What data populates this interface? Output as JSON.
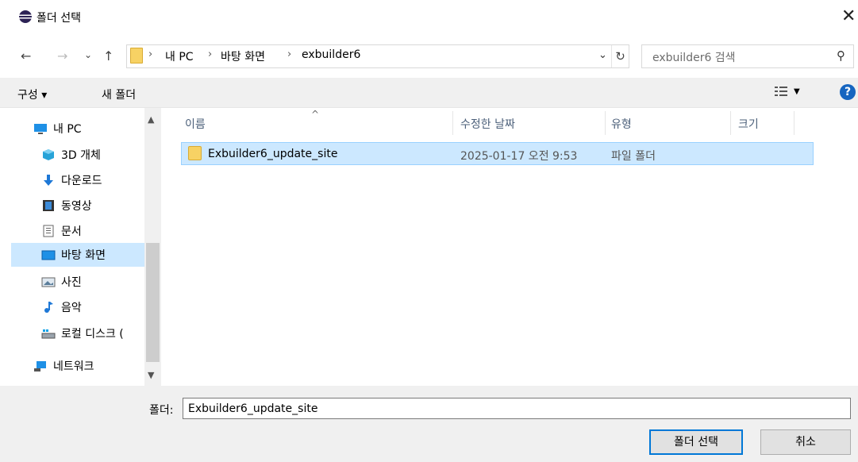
{
  "window": {
    "title": "폴더 선택",
    "close_glyph": "✕"
  },
  "nav_buttons": {
    "back": "←",
    "forward": "→",
    "recent": "⌄",
    "up": "↑"
  },
  "address": {
    "crumbs": [
      "내 PC",
      "바탕 화면",
      "exbuilder6"
    ],
    "separator": "›",
    "dropdown_glyph": "⌄",
    "refresh_glyph": "↻"
  },
  "search": {
    "placeholder": "exbuilder6 검색",
    "icon": "⚲"
  },
  "toolbar": {
    "organize": "구성 ▾",
    "new_folder": "새 폴더",
    "view_dd": "▼",
    "help": "?"
  },
  "sidebar": {
    "items": [
      {
        "label": "내 PC",
        "icon": "pc-icon"
      },
      {
        "label": "3D 개체",
        "icon": "cube-icon"
      },
      {
        "label": "다운로드",
        "icon": "download-icon"
      },
      {
        "label": "동영상",
        "icon": "video-icon"
      },
      {
        "label": "문서",
        "icon": "document-icon"
      },
      {
        "label": "바탕 화면",
        "icon": "desktop-icon",
        "selected": true
      },
      {
        "label": "사진",
        "icon": "picture-icon"
      },
      {
        "label": "음악",
        "icon": "music-icon"
      },
      {
        "label": "로컬 디스크 (",
        "icon": "drive-icon"
      },
      {
        "label": "네트워크",
        "icon": "network-icon"
      }
    ],
    "scroll_up": "▲",
    "scroll_down": "▼"
  },
  "columns": {
    "name": "이름",
    "modified": "수정한 날짜",
    "type": "유형",
    "size": "크기",
    "sort_arrow": "^"
  },
  "files": [
    {
      "name": "Exbuilder6_update_site",
      "modified": "2025-01-17 오전 9:53",
      "type": "파일 폴더",
      "size": ""
    }
  ],
  "footer": {
    "folder_label": "폴더:",
    "folder_value": "Exbuilder6_update_site",
    "select_button": "폴더 선택",
    "cancel_button": "취소"
  },
  "colors": {
    "selection": "#cce8ff",
    "accent": "#0078d7",
    "folder": "#f7d264"
  }
}
